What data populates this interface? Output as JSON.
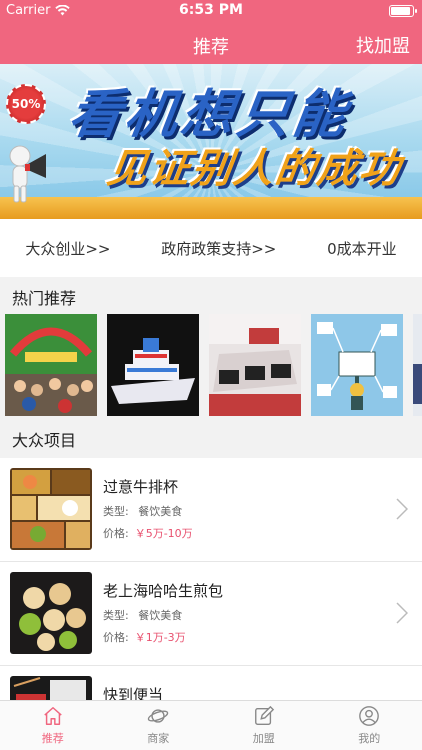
{
  "status": {
    "carrier": "Carrier",
    "time": "6:53 PM"
  },
  "nav": {
    "title": "推荐",
    "right_button": "找加盟"
  },
  "banner": {
    "sale_badge": "50%",
    "slogan_line1": "看机想只能",
    "slogan_line2": "见证别人的成功"
  },
  "quick_links": [
    "大众创业>>",
    "政府政策支持>>",
    "0成本开业"
  ],
  "hot_section": {
    "title": "热门推荐"
  },
  "projects_section": {
    "title": "大众项目"
  },
  "projects": [
    {
      "name": "过意牛排杯",
      "type_label": "类型:",
      "type_value": "餐饮美食",
      "price_label": "价格:",
      "price_value": "￥5万-10万"
    },
    {
      "name": "老上海哈哈生煎包",
      "type_label": "类型:",
      "type_value": "餐饮美食",
      "price_label": "价格:",
      "price_value": "￥1万-3万"
    },
    {
      "name": "快到便当"
    }
  ],
  "tabs": [
    {
      "label": "推荐",
      "icon": "home-icon",
      "active": true
    },
    {
      "label": "商家",
      "icon": "planet-icon",
      "active": false
    },
    {
      "label": "加盟",
      "icon": "edit-icon",
      "active": false
    },
    {
      "label": "我的",
      "icon": "user-icon",
      "active": false
    }
  ],
  "colors": {
    "accent": "#f0667f",
    "price": "#e8506e"
  }
}
